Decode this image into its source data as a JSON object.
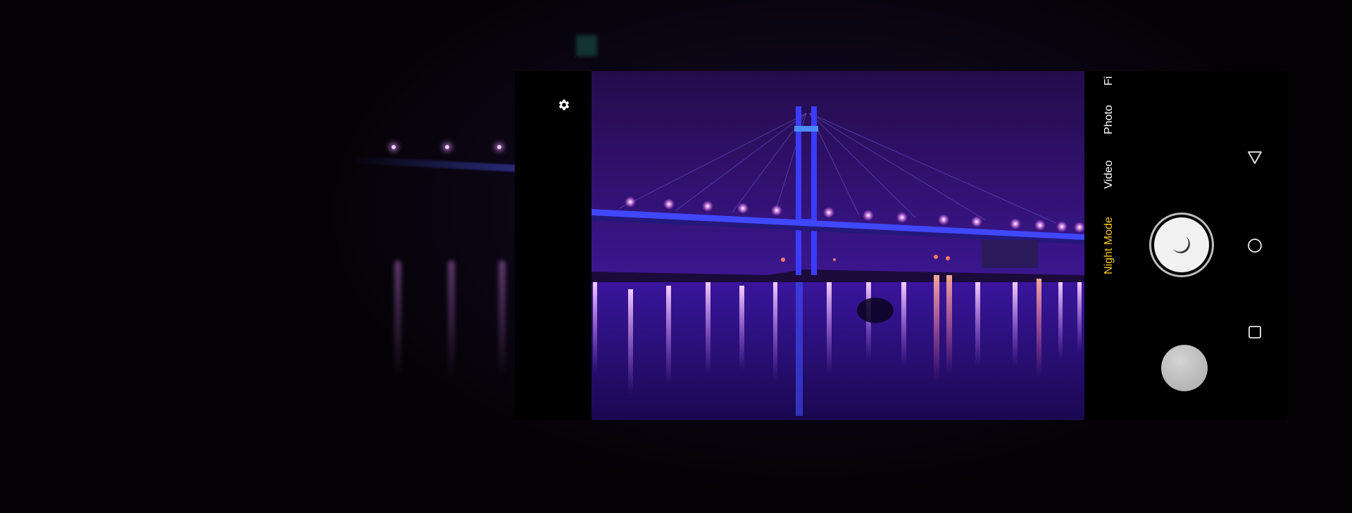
{
  "camera": {
    "modes": [
      {
        "label": "Fi",
        "state": "partial"
      },
      {
        "label": "Photo",
        "state": "inactive"
      },
      {
        "label": "Video",
        "state": "inactive"
      },
      {
        "label": "Night Mode",
        "state": "active"
      }
    ],
    "active_mode": "Night Mode",
    "accent_color": "#f1c40f"
  },
  "icons": {
    "settings": "gear-icon",
    "shutter": "moon-icon",
    "gallery": "gallery-thumbnail",
    "back": "triangle-back-icon",
    "home": "circle-home-icon",
    "recents": "square-recents-icon"
  }
}
